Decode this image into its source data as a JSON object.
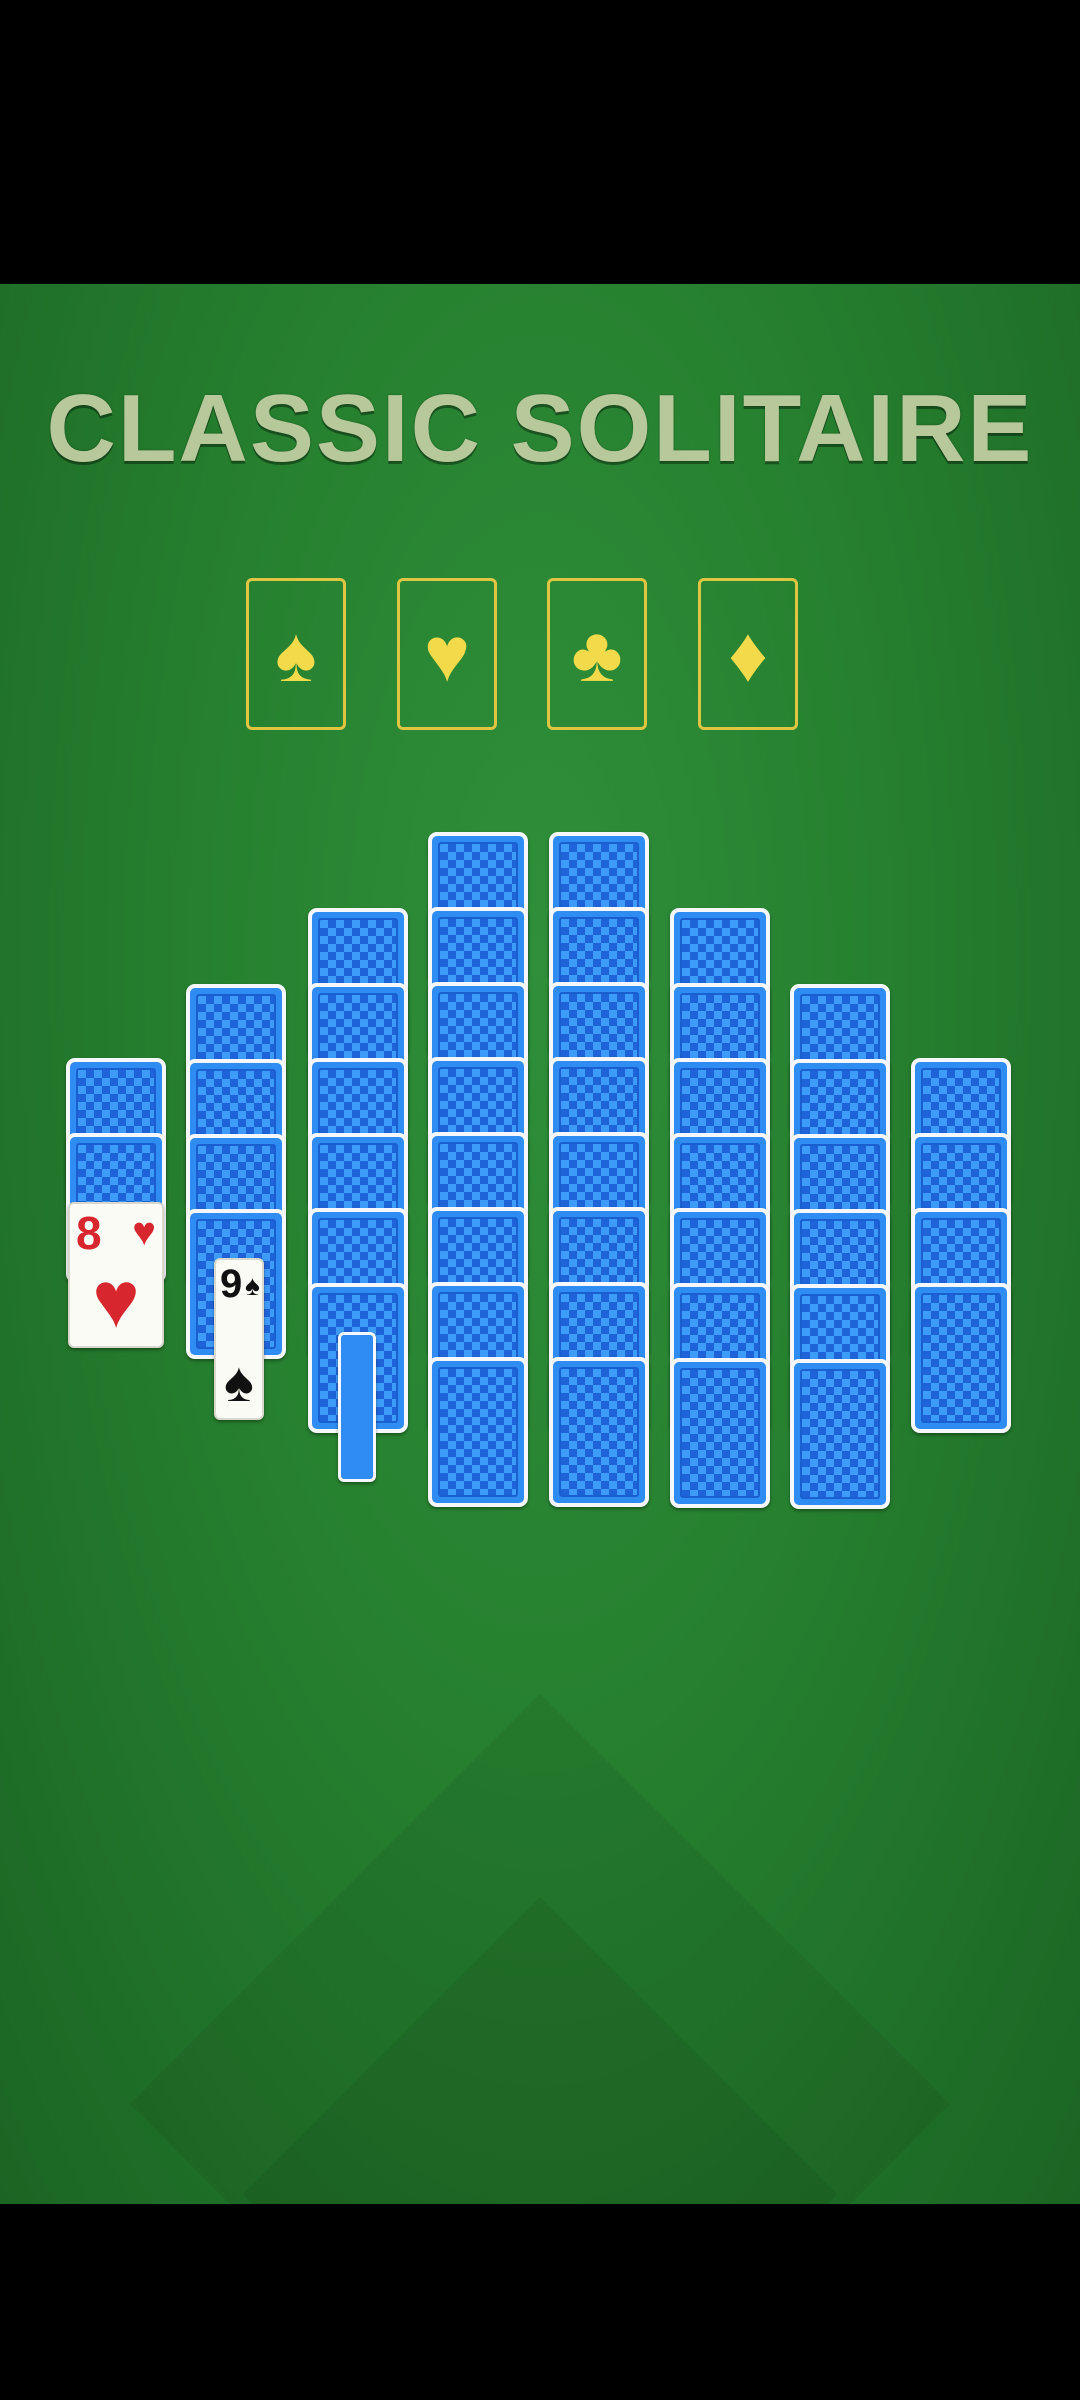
{
  "title": "CLASSIC SOLITAIRE",
  "foundations": [
    {
      "suit": "♠",
      "icon": "spade-icon"
    },
    {
      "suit": "♥",
      "icon": "heart-icon"
    },
    {
      "suit": "♣",
      "icon": "club-icon"
    },
    {
      "suit": "♦",
      "icon": "diamond-icon"
    }
  ],
  "face_up_cards": [
    {
      "rank": "8",
      "suit": "♥",
      "color": "red"
    },
    {
      "rank": "9",
      "suit": "♠",
      "color": "black"
    }
  ],
  "colors": {
    "felt": "#26802f",
    "card_back": "#2f8cf2",
    "foundation_outline": "#e0c542",
    "title": "#b7c99a"
  }
}
